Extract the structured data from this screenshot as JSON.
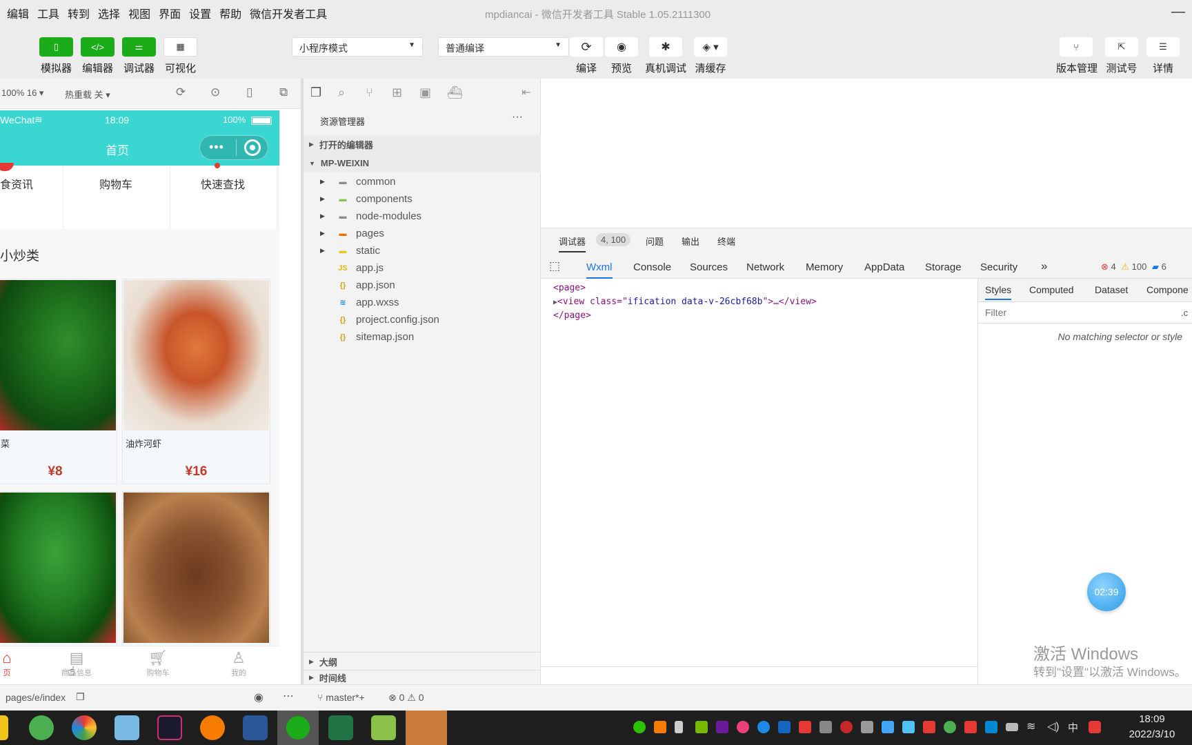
{
  "menubar": {
    "items": [
      "编辑",
      "工具",
      "转到",
      "选择",
      "视图",
      "界面",
      "设置",
      "帮助",
      "微信开发者工具"
    ],
    "title": "mpdiancai",
    "title_suffix": "- 微信开发者工具 Stable 1.05.2111300",
    "minimize": "—"
  },
  "toolbar": {
    "simulator": "模拟器",
    "editor": "编辑器",
    "debugger": "调试器",
    "visual": "可视化",
    "mode_select": "小程序模式",
    "compile_select": "普通编译",
    "compile": "编译",
    "preview": "预览",
    "real_debug": "真机调试",
    "clear_cache": "清缓存",
    "version_mgmt": "版本管理",
    "test_account": "测试号",
    "details": "详情"
  },
  "simbar": {
    "zoom": "100% 16 ▾",
    "hotreload": "热重载 关 ▾"
  },
  "phone": {
    "carrier": "WeChat",
    "time": "18:09",
    "battery": "100%",
    "nav_title": "首页",
    "categories": [
      "食资讯",
      "购物车",
      "快速查找"
    ],
    "section_title": "小炒类",
    "foods": [
      {
        "name": "菜",
        "price": "¥8"
      },
      {
        "name": "油炸河虾",
        "price": "¥16"
      },
      {
        "name": "",
        "price": ""
      },
      {
        "name": "",
        "price": ""
      }
    ],
    "tabs": [
      "页",
      "商品信息",
      "购物车",
      "我的"
    ]
  },
  "explorer": {
    "title": "资源管理器",
    "more": "···",
    "open_editors": "打开的编辑器",
    "project": "MP-WEIXIN",
    "items": [
      {
        "name": "common",
        "type": "folder"
      },
      {
        "name": "components",
        "type": "folder"
      },
      {
        "name": "node-modules",
        "type": "folder"
      },
      {
        "name": "pages",
        "type": "folder"
      },
      {
        "name": "static",
        "type": "folder"
      },
      {
        "name": "app.js",
        "type": "js"
      },
      {
        "name": "app.json",
        "type": "json"
      },
      {
        "name": "app.wxss",
        "type": "wxss"
      },
      {
        "name": "project.config.json",
        "type": "json"
      },
      {
        "name": "sitemap.json",
        "type": "json"
      }
    ],
    "outline": "大纲",
    "timeline": "时间线"
  },
  "debugger": {
    "tab_debugger": "调试器",
    "badge": "4, 100",
    "tab_issues": "问题",
    "tab_output": "输出",
    "tab_terminal": "终端",
    "tabs": [
      "Wxml",
      "Console",
      "Sources",
      "Network",
      "Memory",
      "AppData",
      "Storage",
      "Security"
    ],
    "more": "»",
    "errors": "4",
    "warnings": "100",
    "infos": "6",
    "wxml_line1": "<page>",
    "wxml_line2_tag": "<view class=\"",
    "wxml_line2_attr": "ification data-v-26cbf68b",
    "wxml_line2_end": "\">…</view>",
    "wxml_line3": "</page>",
    "styles_tabs": [
      "Styles",
      "Computed",
      "Dataset",
      "Compone"
    ],
    "filter_placeholder": "Filter",
    "filter_suffix": ".c",
    "no_match": "No matching selector or style",
    "timer": "02:39",
    "watermark1": "激活 Windows",
    "watermark2": "转到\"设置\"以激活 Windows。"
  },
  "statusline": {
    "path": "pages/e/index",
    "branch": "master*+",
    "errors": "0",
    "warnings": "0"
  },
  "taskbar": {
    "ime": "中",
    "time": "18:09",
    "date": "2022/3/10"
  },
  "colors": {
    "accent_green": "#1aad19",
    "phone_nav": "#3ad7d2",
    "price_red": "#c0392b",
    "active_tab": "#07c160"
  }
}
